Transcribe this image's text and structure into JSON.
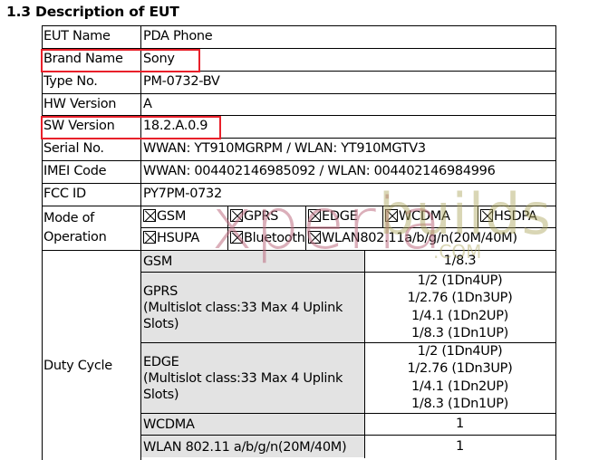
{
  "heading": "1.3 Description of EUT",
  "rows": [
    {
      "label": "EUT Name",
      "value": "PDA Phone"
    },
    {
      "label": "Brand Name",
      "value": "Sony",
      "highlighted": true
    },
    {
      "label": "Type No.",
      "value": "PM-0732-BV"
    },
    {
      "label": "HW Version",
      "value": "A"
    },
    {
      "label": "SW Version",
      "value": "18.2.A.0.9",
      "highlighted": true
    },
    {
      "label": "Serial No.",
      "value": "WWAN: YT910MGRPM / WLAN: YT910MGTV3"
    },
    {
      "label": "IMEI Code",
      "value": "WWAN: 004402146985092 / WLAN: 004402146984996"
    },
    {
      "label": "FCC ID",
      "value": "PY7PM-0732"
    }
  ],
  "mode_of_operation": {
    "label_line1": "Mode of",
    "label_line2": "Operation",
    "modes": [
      {
        "name": "GSM",
        "checked": true
      },
      {
        "name": "GPRS",
        "checked": true
      },
      {
        "name": "EDGE",
        "checked": true
      },
      {
        "name": "WCDMA",
        "checked": true
      },
      {
        "name": "HSDPA",
        "checked": true
      },
      {
        "name": "HSUPA",
        "checked": true
      },
      {
        "name": "Bluetooth",
        "checked": true
      },
      {
        "name": "WLAN802.11a/b/g/n(20M/40M)",
        "checked": true
      }
    ]
  },
  "duty_cycle": {
    "label": "Duty Cycle",
    "entries": [
      {
        "mode": [
          "GSM"
        ],
        "values": [
          "1/8.3"
        ]
      },
      {
        "mode": [
          "GPRS",
          "(Multislot class:33 Max 4 Uplink",
          "Slots)"
        ],
        "values": [
          "1/2 (1Dn4UP)",
          "1/2.76 (1Dn3UP)",
          "1/4.1 (1Dn2UP)",
          "1/8.3 (1Dn1UP)"
        ]
      },
      {
        "mode": [
          "EDGE",
          "(Multislot class:33 Max 4 Uplink",
          "Slots)"
        ],
        "values": [
          "1/2 (1Dn4UP)",
          "1/2.76 (1Dn3UP)",
          "1/4.1 (1Dn2UP)",
          "1/8.3 (1Dn1UP)"
        ]
      },
      {
        "mode": [
          "WCDMA"
        ],
        "values": [
          "1"
        ]
      },
      {
        "mode": [
          "WLAN 802.11 a/b/g/n(20M/40M)"
        ],
        "values": [
          "1"
        ]
      }
    ]
  },
  "watermark": {
    "left": "xperia",
    "right": "builds",
    "suffix": ".COM"
  },
  "colors": {
    "highlight_box": "#e8202a",
    "shaded_cell": "#e3e3e3"
  }
}
